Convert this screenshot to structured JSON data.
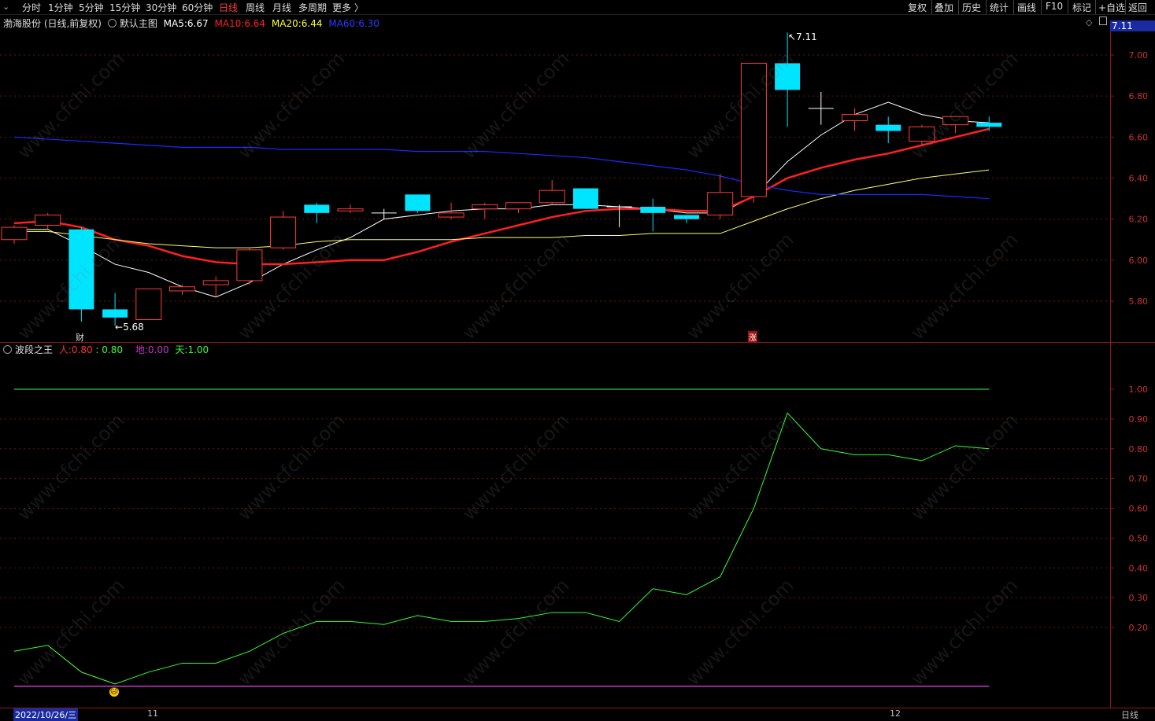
{
  "toolbar": {
    "periods": [
      "分时",
      "1分钟",
      "5分钟",
      "15分钟",
      "30分钟",
      "60分钟",
      "日线",
      "周线",
      "月线",
      "多周期",
      "更多 〉"
    ],
    "active_period": "日线",
    "right_buttons": [
      "复权",
      "叠加",
      "历史",
      "统计",
      "画线",
      "F10",
      "标记",
      "+自选",
      "返回"
    ]
  },
  "main_legend": {
    "stock": "渤海股份 (日线,前复权)",
    "template": "默认主图",
    "ma5_label": "MA5:",
    "ma5_value": "6.67",
    "ma10_label": "MA10:",
    "ma10_value": "6.64",
    "ma20_label": "MA20:",
    "ma20_value": "6.44",
    "ma60_label": "MA60:",
    "ma60_value": "6.30",
    "current_price": "7.11"
  },
  "sub_legend": {
    "indicator": "波段之王",
    "ren_label": "人:",
    "ren_value": "0.80",
    "ren_value2": "0.80",
    "di_label": "地:",
    "di_value": "0.00",
    "tian_label": "天:",
    "tian_value": "1.00"
  },
  "annotations": {
    "high": "7.11",
    "low": "5.68",
    "cai_marker": "财",
    "zhang_marker": "涨"
  },
  "dates": {
    "left": "2022/10/26/三",
    "month_11": "11",
    "month_12": "12",
    "period_right": "日线"
  },
  "watermark": "www.cfchi.com",
  "colors": {
    "up": "#ff3b3b",
    "down": "#00e5ff",
    "ma5": "#ffffff",
    "ma10": "#ff2020",
    "ma20": "#ffff66",
    "ma60": "#1a2aff",
    "ind_line": "#33ff33",
    "di_line": "#cc33cc"
  },
  "chart_data": [
    {
      "type": "candlestick",
      "title": "渤海股份 (日线,前复权)",
      "yticks": [
        5.8,
        6.0,
        6.2,
        6.4,
        6.6,
        6.8,
        7.0
      ],
      "ylim": [
        5.62,
        7.15
      ],
      "candles": [
        {
          "o": 6.1,
          "c": 6.16,
          "h": 6.17,
          "l": 6.08
        },
        {
          "o": 6.17,
          "c": 6.22,
          "h": 6.23,
          "l": 6.15
        },
        {
          "o": 6.15,
          "c": 5.76,
          "h": 6.16,
          "l": 5.7
        },
        {
          "o": 5.76,
          "c": 5.72,
          "h": 5.84,
          "l": 5.68
        },
        {
          "o": 5.71,
          "c": 5.86,
          "h": 5.86,
          "l": 5.71
        },
        {
          "o": 5.85,
          "c": 5.87,
          "h": 5.88,
          "l": 5.83
        },
        {
          "o": 5.88,
          "c": 5.9,
          "h": 5.92,
          "l": 5.82
        },
        {
          "o": 5.9,
          "c": 6.05,
          "h": 6.06,
          "l": 5.88
        },
        {
          "o": 6.06,
          "c": 6.21,
          "h": 6.24,
          "l": 6.05
        },
        {
          "o": 6.27,
          "c": 6.23,
          "h": 6.28,
          "l": 6.18
        },
        {
          "o": 6.24,
          "c": 6.25,
          "h": 6.27,
          "l": 6.23
        },
        {
          "o": 6.23,
          "c": 6.23,
          "h": 6.25,
          "l": 6.2
        },
        {
          "o": 6.32,
          "c": 6.24,
          "h": 6.32,
          "l": 6.23
        },
        {
          "o": 6.21,
          "c": 6.23,
          "h": 6.28,
          "l": 6.2
        },
        {
          "o": 6.25,
          "c": 6.27,
          "h": 6.28,
          "l": 6.2
        },
        {
          "o": 6.25,
          "c": 6.28,
          "h": 6.28,
          "l": 6.23
        },
        {
          "o": 6.28,
          "c": 6.34,
          "h": 6.39,
          "l": 6.27
        },
        {
          "o": 6.35,
          "c": 6.25,
          "h": 6.35,
          "l": 6.25
        },
        {
          "o": 6.26,
          "c": 6.26,
          "h": 6.27,
          "l": 6.16
        },
        {
          "o": 6.26,
          "c": 6.23,
          "h": 6.3,
          "l": 6.14
        },
        {
          "o": 6.22,
          "c": 6.2,
          "h": 6.22,
          "l": 6.18
        },
        {
          "o": 6.22,
          "c": 6.33,
          "h": 6.42,
          "l": 6.2
        },
        {
          "o": 6.31,
          "c": 6.96,
          "h": 6.96,
          "l": 6.28
        },
        {
          "o": 6.96,
          "c": 6.83,
          "h": 7.11,
          "l": 6.65
        },
        {
          "o": 6.74,
          "c": 6.74,
          "h": 6.82,
          "l": 6.66
        },
        {
          "o": 6.68,
          "c": 6.71,
          "h": 6.74,
          "l": 6.63
        },
        {
          "o": 6.66,
          "c": 6.63,
          "h": 6.7,
          "l": 6.57
        },
        {
          "o": 6.58,
          "c": 6.65,
          "h": 6.66,
          "l": 6.56
        },
        {
          "o": 6.66,
          "c": 6.7,
          "h": 6.7,
          "l": 6.62
        },
        {
          "o": 6.67,
          "c": 6.65,
          "h": 6.7,
          "l": 6.63
        }
      ],
      "series": [
        {
          "name": "MA5",
          "values": [
            6.15,
            6.15,
            6.07,
            5.98,
            5.94,
            5.87,
            5.82,
            5.89,
            5.98,
            6.05,
            6.11,
            6.2,
            6.22,
            6.24,
            6.25,
            6.25,
            6.27,
            6.27,
            6.26,
            6.25,
            6.23,
            6.23,
            6.31,
            6.48,
            6.61,
            6.71,
            6.77,
            6.71,
            6.68,
            6.67
          ]
        },
        {
          "name": "MA10",
          "values": [
            6.18,
            6.19,
            6.16,
            6.1,
            6.07,
            6.02,
            5.99,
            5.98,
            5.98,
            5.99,
            6.0,
            6.0,
            6.04,
            6.09,
            6.13,
            6.17,
            6.21,
            6.24,
            6.25,
            6.25,
            6.24,
            6.24,
            6.31,
            6.4,
            6.45,
            6.49,
            6.52,
            6.56,
            6.6,
            6.64
          ]
        },
        {
          "name": "MA20",
          "values": [
            6.14,
            6.14,
            6.12,
            6.1,
            6.08,
            6.07,
            6.06,
            6.06,
            6.07,
            6.09,
            6.1,
            6.1,
            6.1,
            6.1,
            6.11,
            6.11,
            6.11,
            6.12,
            6.12,
            6.13,
            6.13,
            6.13,
            6.19,
            6.25,
            6.3,
            6.34,
            6.37,
            6.4,
            6.42,
            6.44
          ]
        },
        {
          "name": "MA60",
          "values": [
            6.6,
            6.59,
            6.58,
            6.57,
            6.56,
            6.55,
            6.55,
            6.55,
            6.54,
            6.54,
            6.54,
            6.54,
            6.53,
            6.53,
            6.53,
            6.52,
            6.51,
            6.5,
            6.48,
            6.46,
            6.44,
            6.41,
            6.37,
            6.34,
            6.32,
            6.32,
            6.32,
            6.32,
            6.31,
            6.3
          ]
        }
      ]
    },
    {
      "type": "line",
      "title": "波段之王",
      "yticks": [
        0.2,
        0.3,
        0.4,
        0.5,
        0.6,
        0.7,
        0.8,
        0.9,
        1.0
      ],
      "ylim": [
        0.0,
        1.05
      ],
      "series": [
        {
          "name": "人",
          "values": [
            0.12,
            0.14,
            0.05,
            0.01,
            0.05,
            0.08,
            0.08,
            0.12,
            0.18,
            0.22,
            0.22,
            0.21,
            0.24,
            0.22,
            0.22,
            0.23,
            0.25,
            0.25,
            0.22,
            0.33,
            0.31,
            0.37,
            0.6,
            0.92,
            0.8,
            0.78,
            0.78,
            0.76,
            0.81,
            0.8
          ]
        },
        {
          "name": "地",
          "values": [
            0.0,
            0.0
          ]
        },
        {
          "name": "天",
          "values": [
            1.0,
            1.0
          ]
        }
      ]
    }
  ]
}
